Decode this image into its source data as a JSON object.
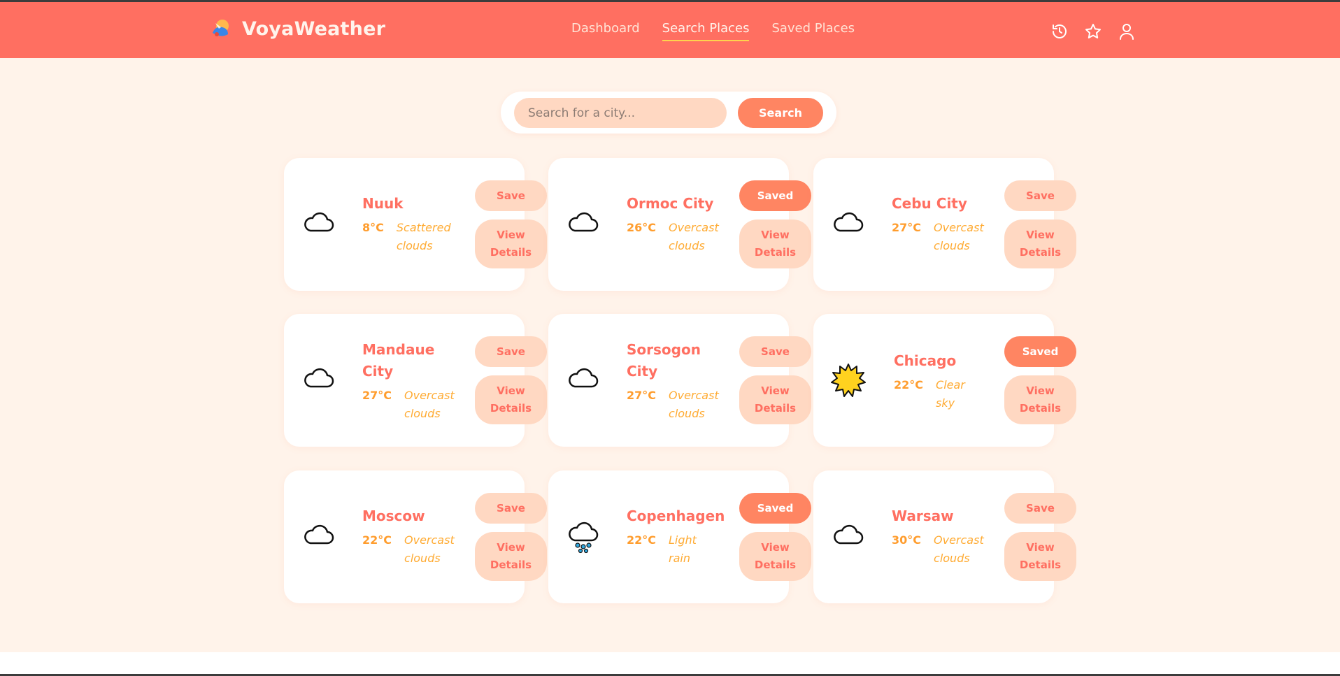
{
  "app": {
    "name": "VoyaWeather"
  },
  "nav": {
    "links": [
      "Dashboard",
      "Search Places",
      "Saved Places"
    ],
    "active_index": 1,
    "icons": [
      "history-icon",
      "star-icon",
      "user-icon"
    ]
  },
  "search": {
    "placeholder": "Search for a city...",
    "value": "",
    "button_label": "Search"
  },
  "colors": {
    "brand": "#ff6f61",
    "page_background": "#fff3ea",
    "accent": "#ff8562",
    "soft_button": "#ffd8c2",
    "temperature": "#ff9d2e"
  },
  "cards": [
    {
      "city": "Nuuk",
      "temp": "8°C",
      "desc": "Scattered clouds",
      "icon": "cloud-icon",
      "save_label": "Save",
      "saved": false,
      "details_label": "View\nDetails"
    },
    {
      "city": "Ormoc City",
      "temp": "26°C",
      "desc": "Overcast clouds",
      "icon": "cloud-icon",
      "save_label": "Saved",
      "saved": true,
      "details_label": "View\nDetails"
    },
    {
      "city": "Cebu City",
      "temp": "27°C",
      "desc": "Overcast clouds",
      "icon": "cloud-icon",
      "save_label": "Save",
      "saved": false,
      "details_label": "View\nDetails"
    },
    {
      "city": "Mandaue City",
      "temp": "27°C",
      "desc": "Overcast clouds",
      "icon": "cloud-icon",
      "save_label": "Save",
      "saved": false,
      "details_label": "View\nDetails"
    },
    {
      "city": "Sorsogon City",
      "temp": "27°C",
      "desc": "Overcast clouds",
      "icon": "cloud-icon",
      "save_label": "Save",
      "saved": false,
      "details_label": "View\nDetails"
    },
    {
      "city": "Chicago",
      "temp": "22°C",
      "desc": "Clear sky",
      "icon": "sun-icon",
      "save_label": "Saved",
      "saved": true,
      "details_label": "View\nDetails"
    },
    {
      "city": "Moscow",
      "temp": "22°C",
      "desc": "Overcast clouds",
      "icon": "cloud-icon",
      "save_label": "Save",
      "saved": false,
      "details_label": "View\nDetails"
    },
    {
      "city": "Copenhagen",
      "temp": "22°C",
      "desc": "Light rain",
      "icon": "rain-cloud-icon",
      "save_label": "Saved",
      "saved": true,
      "details_label": "View\nDetails"
    },
    {
      "city": "Warsaw",
      "temp": "30°C",
      "desc": "Overcast clouds",
      "icon": "cloud-icon",
      "save_label": "Save",
      "saved": false,
      "details_label": "View\nDetails"
    }
  ]
}
